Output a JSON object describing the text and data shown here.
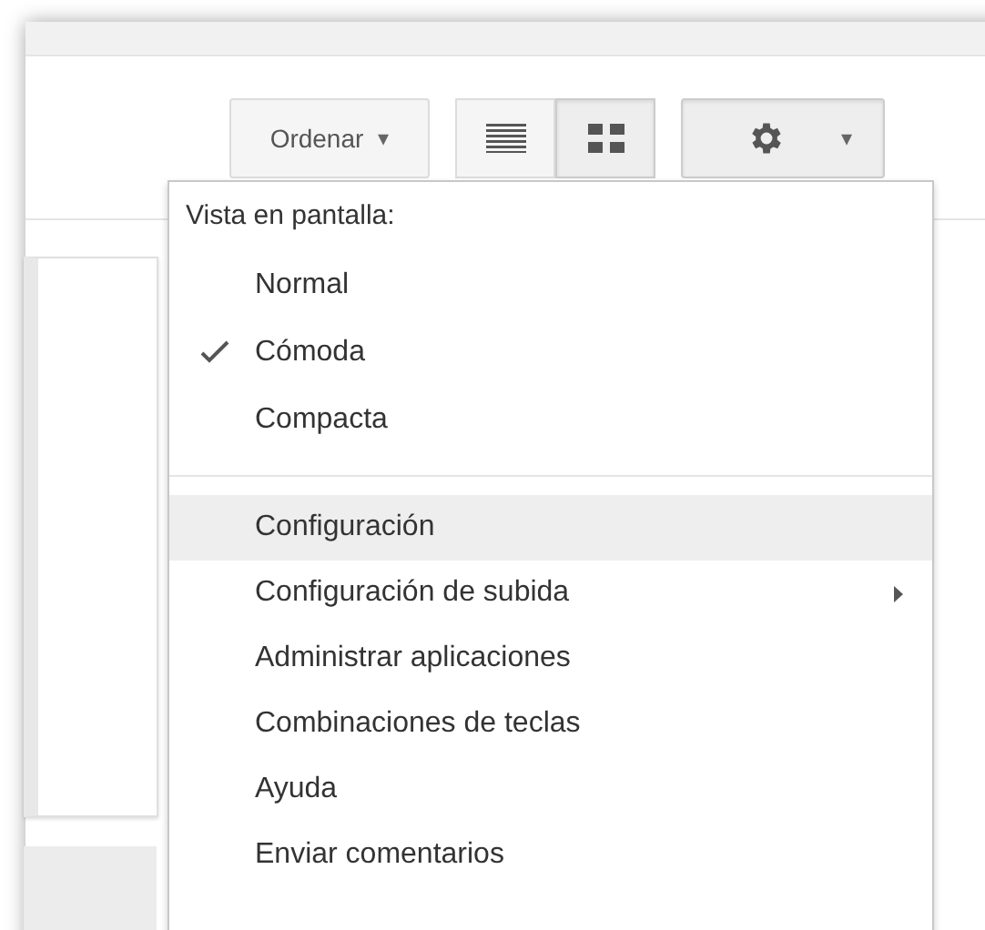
{
  "toolbar": {
    "sort_button": {
      "label": "Ordenar",
      "arrow": "▾"
    },
    "view_toggle": [
      {
        "kind": "list",
        "selected": false
      },
      {
        "kind": "grid",
        "selected": true
      }
    ],
    "settings_button": {
      "arrow": "▾",
      "open": true
    }
  },
  "menu": {
    "header": "Vista en pantalla:",
    "density": [
      {
        "label": "Normal",
        "selected": false
      },
      {
        "label": "Cómoda",
        "selected": true
      },
      {
        "label": "Compacta",
        "selected": false
      }
    ],
    "items": [
      {
        "label": "Configuración",
        "highlighted": true,
        "submenu": false
      },
      {
        "label": "Configuración de subida",
        "highlighted": false,
        "submenu": true
      },
      {
        "label": "Administrar aplicaciones",
        "highlighted": false,
        "submenu": false
      },
      {
        "label": "Combinaciones de teclas",
        "highlighted": false,
        "submenu": false
      },
      {
        "label": "Ayuda",
        "highlighted": false,
        "submenu": false
      },
      {
        "label": "Enviar comentarios",
        "highlighted": false,
        "submenu": false
      }
    ]
  }
}
